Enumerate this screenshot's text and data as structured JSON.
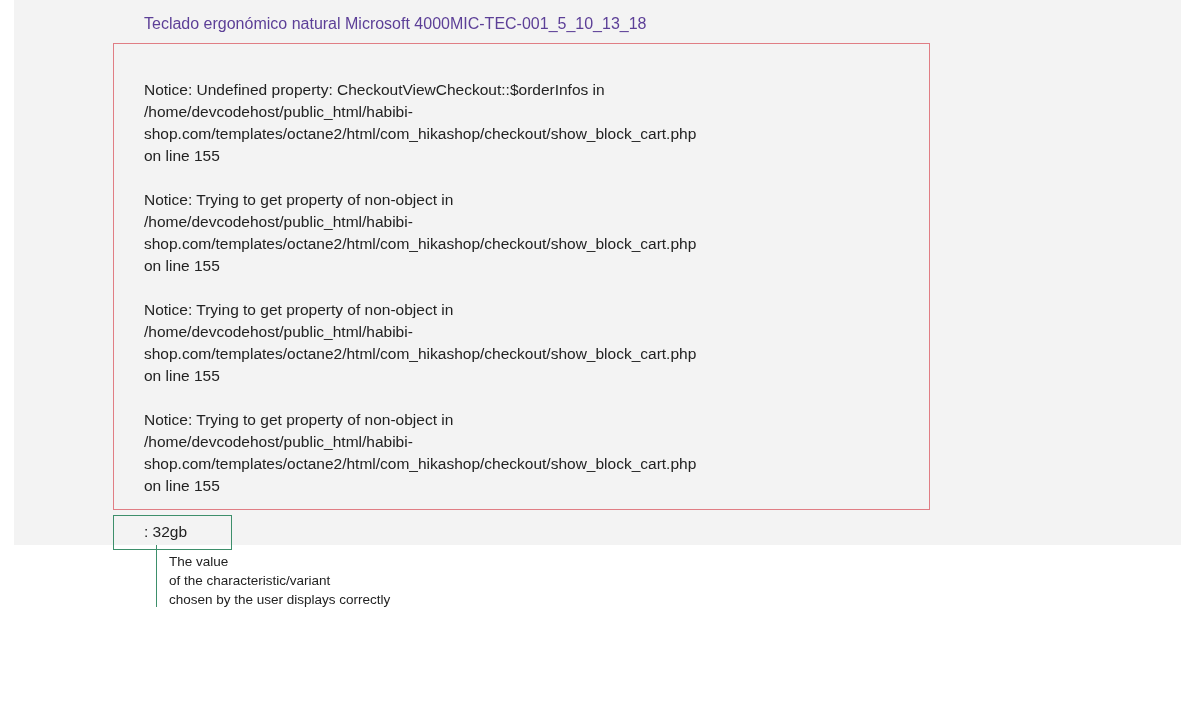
{
  "product_title": "Teclado ergonómico natural Microsoft 4000MIC-TEC-001_5_10_13_18",
  "notices": [
    {
      "lines": [
        "Notice: Undefined property: CheckoutViewCheckout::$orderInfos in",
        "/home/devcodehost/public_html/habibi-",
        "shop.com/templates/octane2/html/com_hikashop/checkout/show_block_cart.php",
        "on line 155"
      ]
    },
    {
      "lines": [
        "Notice: Trying to get property of non-object in",
        "/home/devcodehost/public_html/habibi-",
        "shop.com/templates/octane2/html/com_hikashop/checkout/show_block_cart.php",
        "on line 155"
      ]
    },
    {
      "lines": [
        "Notice: Trying to get property of non-object in",
        "/home/devcodehost/public_html/habibi-",
        "shop.com/templates/octane2/html/com_hikashop/checkout/show_block_cart.php",
        "on line 155"
      ]
    },
    {
      "lines": [
        "Notice: Trying to get property of non-object in",
        "/home/devcodehost/public_html/habibi-",
        "shop.com/templates/octane2/html/com_hikashop/checkout/show_block_cart.php",
        "on line 155"
      ]
    }
  ],
  "variant_value": ": 32gb",
  "annotation": {
    "lines": [
      "The value",
      "of the characteristic/variant",
      "chosen by the user displays correctly"
    ]
  }
}
